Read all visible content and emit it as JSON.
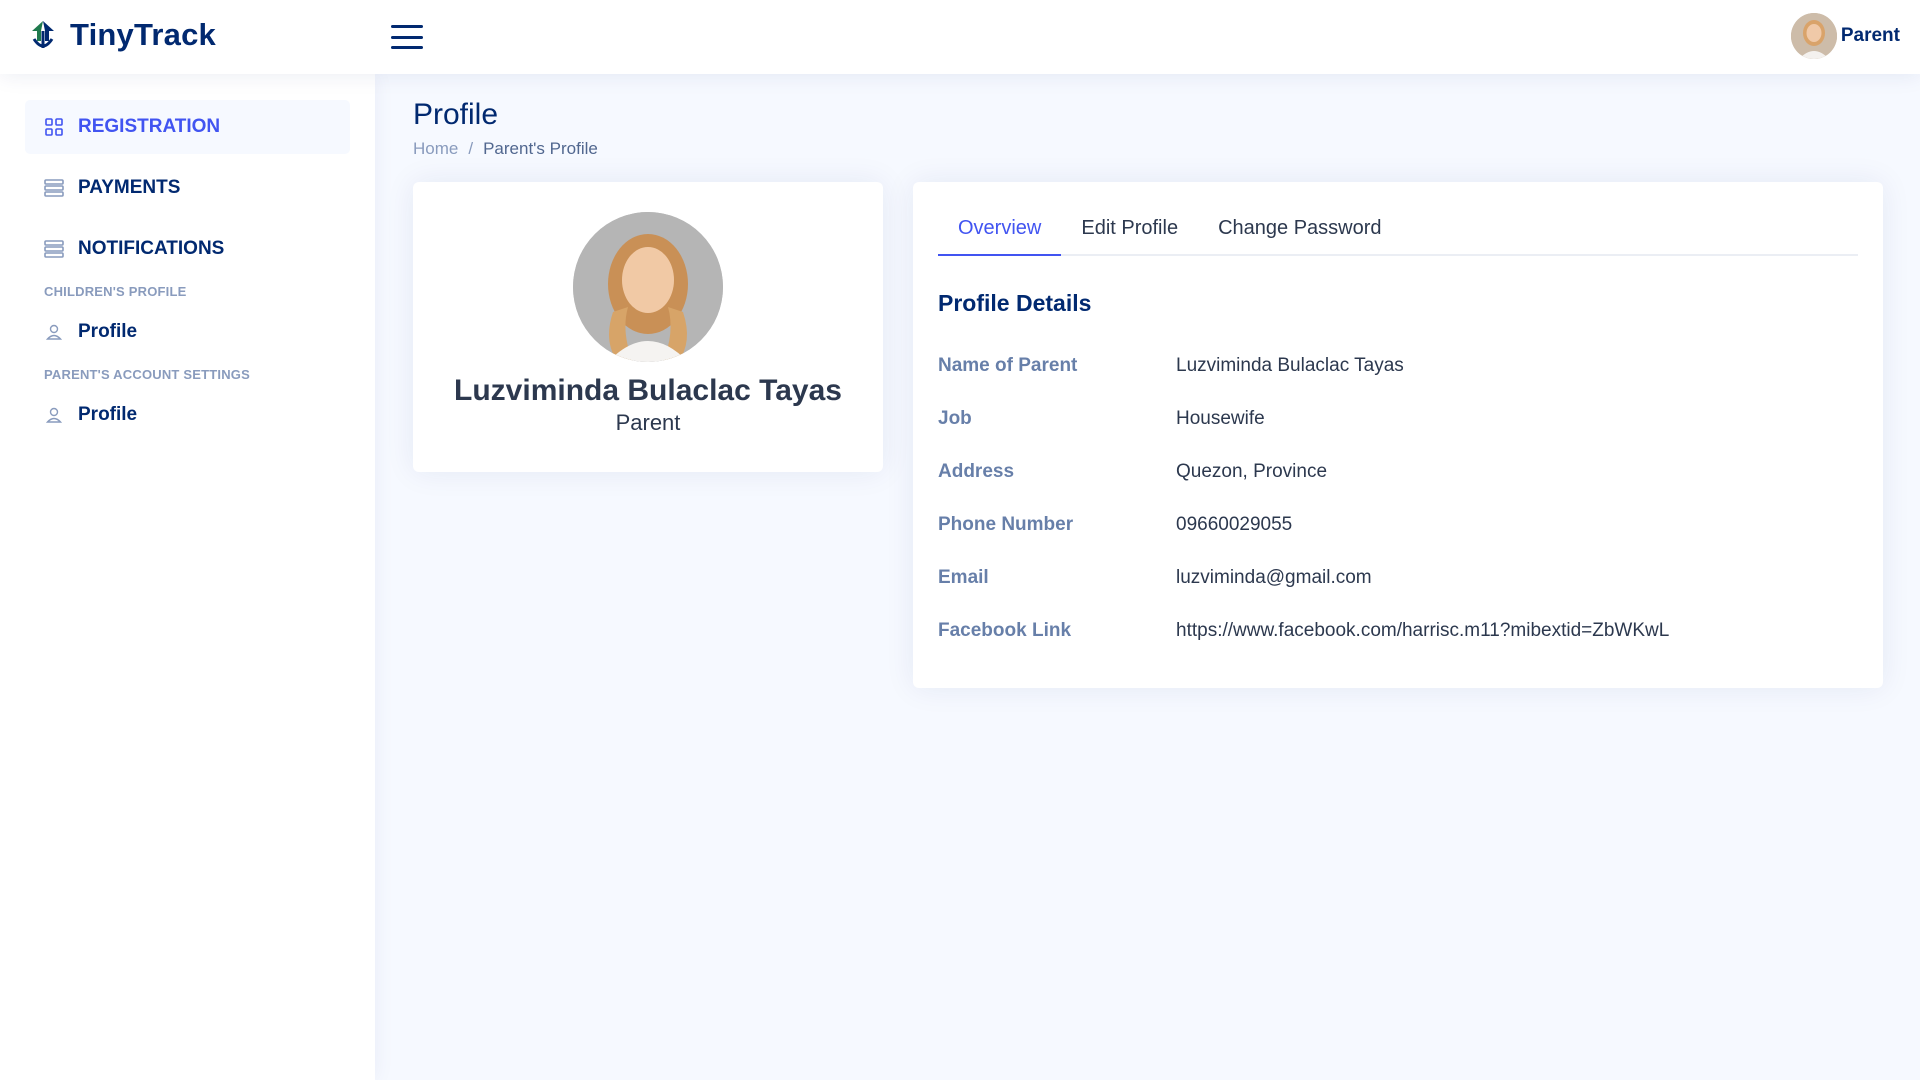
{
  "app": {
    "name": "TinyTrack",
    "colors": {
      "brand": "#012970",
      "accent": "#4154f1",
      "logo_green": "#1f7a4d",
      "background": "#f6f9ff"
    }
  },
  "header": {
    "menu_icon": "hamburger-icon",
    "user": {
      "name": "Parent",
      "avatar_icon": "user-avatar"
    }
  },
  "sidebar": {
    "items": [
      {
        "label": "REGISTRATION",
        "icon": "grid-icon",
        "active": true
      },
      {
        "label": "PAYMENTS",
        "icon": "list-icon"
      },
      {
        "label": "NOTIFICATIONS",
        "icon": "list-icon"
      }
    ],
    "sections": [
      {
        "heading": "CHILDREN'S PROFILE",
        "items": [
          {
            "label": "Profile",
            "icon": "person-icon"
          }
        ]
      },
      {
        "heading": "PARENT'S ACCOUNT SETTINGS",
        "items": [
          {
            "label": "Profile",
            "icon": "person-icon"
          }
        ]
      }
    ]
  },
  "page": {
    "title": "Profile",
    "breadcrumb": {
      "home": "Home",
      "separator": "/",
      "current": "Parent's Profile"
    }
  },
  "profile_card": {
    "name": "Luzviminda Bulaclac Tayas",
    "role": "Parent"
  },
  "details": {
    "tabs": [
      "Overview",
      "Edit Profile",
      "Change Password"
    ],
    "active_tab": "Overview",
    "section_title": "Profile Details",
    "rows": [
      {
        "label": "Name of Parent",
        "value": "Luzviminda Bulaclac Tayas"
      },
      {
        "label": "Job",
        "value": "Housewife"
      },
      {
        "label": "Address",
        "value": "Quezon, Province"
      },
      {
        "label": "Phone Number",
        "value": "09660029055"
      },
      {
        "label": "Email",
        "value": "luzviminda@gmail.com"
      },
      {
        "label": "Facebook Link",
        "value": "https://www.facebook.com/harrisc.m11?mibextid=ZbWKwL"
      }
    ]
  }
}
